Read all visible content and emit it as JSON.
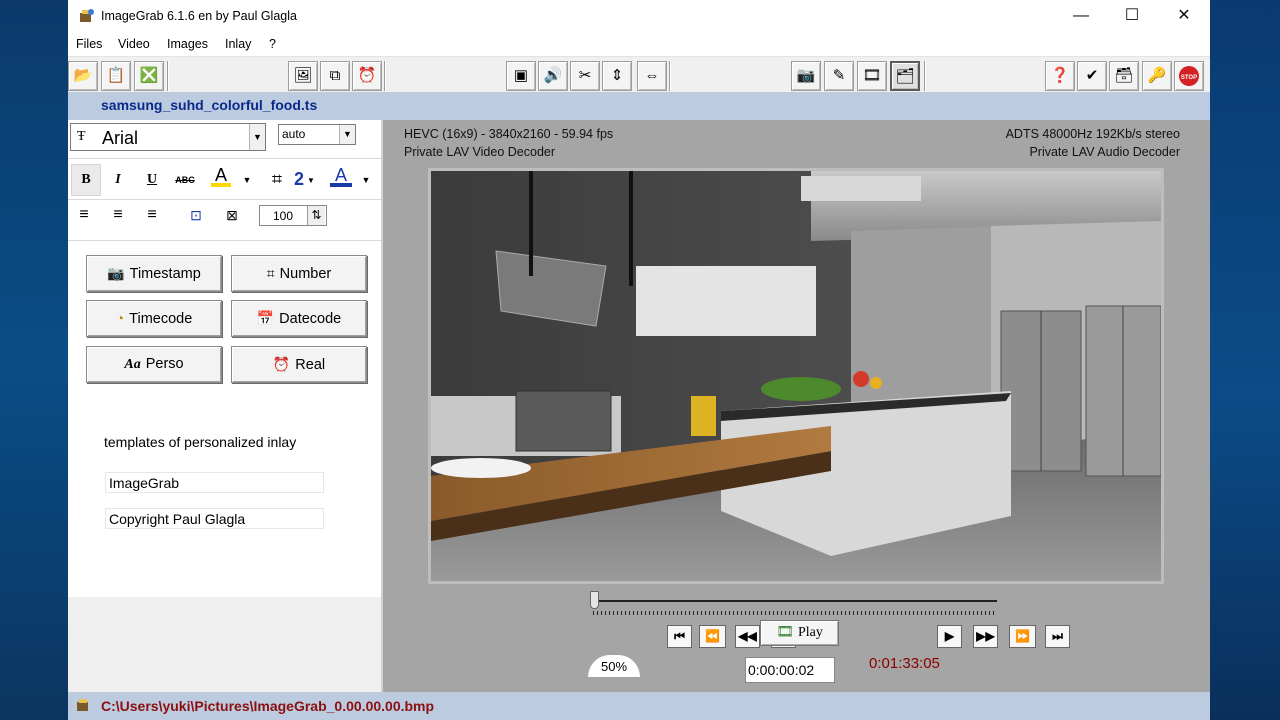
{
  "window": {
    "title": "ImageGrab 6.1.6 en by Paul Glagla",
    "minimize": "—",
    "maximize": "☐",
    "close": "✕"
  },
  "menu": [
    "Files",
    "Video",
    "Images",
    "Inlay",
    "?"
  ],
  "file_title": "samsung_suhd_colorful_food.ts",
  "font_panel": {
    "font_name": "Arial",
    "font_size": "auto",
    "bold": "B",
    "italic": "I",
    "underline": "U",
    "strike": "ABC",
    "outline": "2",
    "opacity": "100"
  },
  "insert_buttons": {
    "timestamp": "Timestamp",
    "number": "Number",
    "timecode": "Timecode",
    "datecode": "Datecode",
    "perso": "Perso",
    "real": "Real"
  },
  "templates": {
    "heading": "templates of personalized inlay",
    "items": [
      "ImageGrab",
      "Copyright Paul Glagla"
    ]
  },
  "video_info": {
    "codec": "HEVC (16x9) - 3840x2160 - 59.94 fps",
    "video_decoder": "Private LAV Video Decoder",
    "audio": "ADTS 48000Hz 192Kb/s stereo",
    "audio_decoder": "Private LAV Audio Decoder"
  },
  "playback": {
    "play_label": "Play",
    "zoom": "50%",
    "position": "0:00:00:02",
    "duration": "0:01:33:05",
    "position_fraction": 0.0
  },
  "status": {
    "path": "C:\\Users\\yuki\\Pictures\\ImageGrab_0.00.00.00.bmp"
  },
  "colors": {
    "file_title": "#0a2a8a",
    "status_text": "#8b1010",
    "duration": "#8b0000",
    "bar_background": "#bccbe0"
  }
}
